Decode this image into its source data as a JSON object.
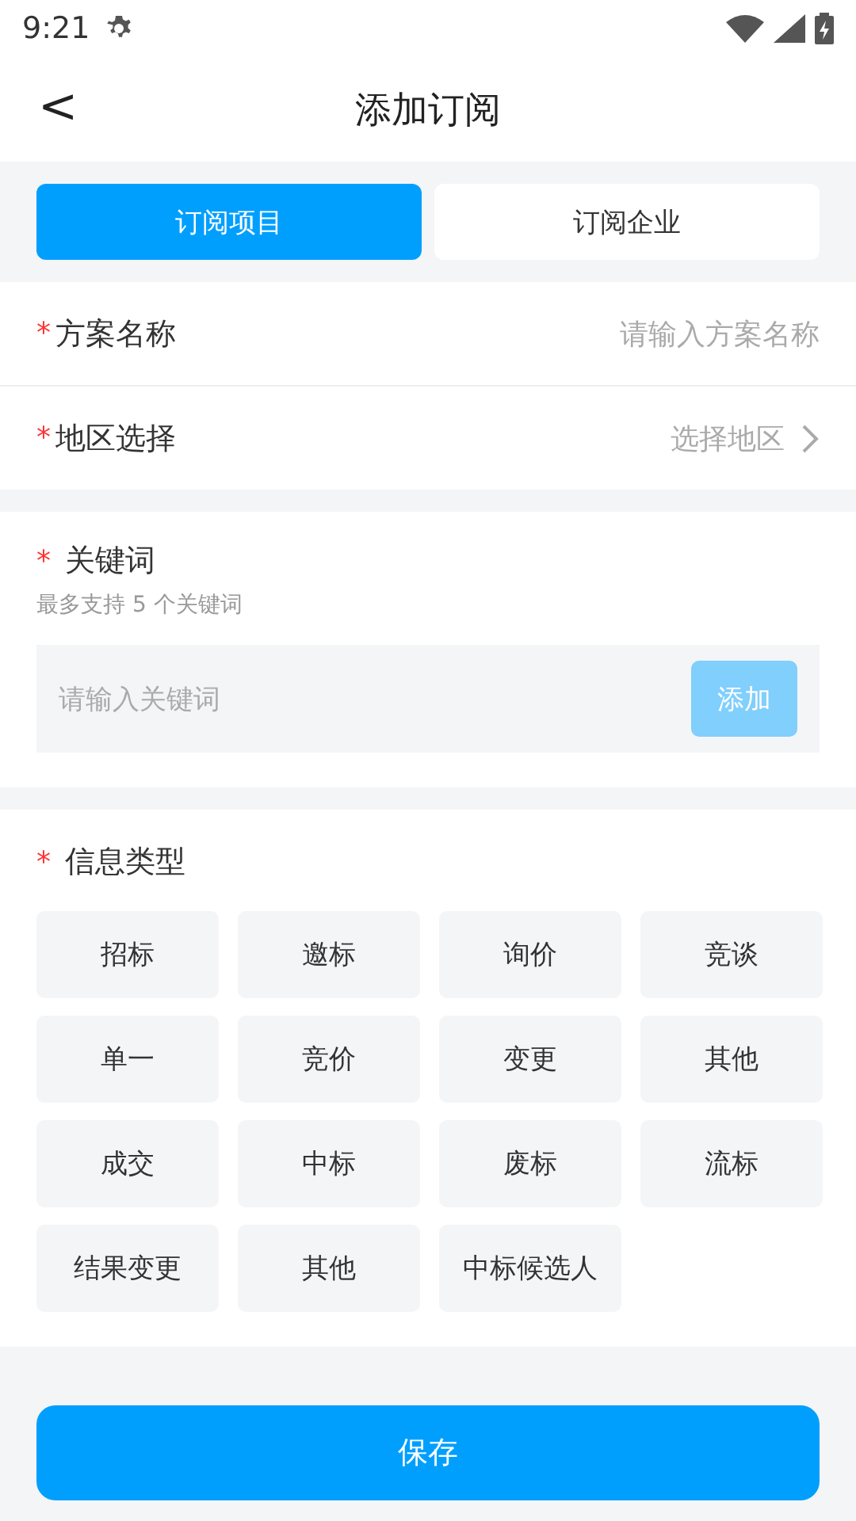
{
  "status_bar": {
    "time": "9:21"
  },
  "header": {
    "back": "<",
    "title": "添加订阅"
  },
  "tabs": [
    {
      "label": "订阅项目",
      "selected": true
    },
    {
      "label": "订阅企业",
      "selected": false
    }
  ],
  "form_rows": [
    {
      "required": "*",
      "label": "方案名称",
      "placeholder": "请输入方案名称",
      "kind": "input"
    },
    {
      "required": "*",
      "label": "地区选择",
      "placeholder": "选择地区",
      "kind": "select"
    }
  ],
  "keywords": {
    "required": "*",
    "title": "关键词",
    "hint": "最多支持 5 个关键词",
    "placeholder": "请输入关键词",
    "add_button": "添加",
    "add_disabled": true
  },
  "info_types": {
    "required": "*",
    "title": "信息类型",
    "options": [
      {
        "label": "招标",
        "selected": false
      },
      {
        "label": "邀标",
        "selected": false
      },
      {
        "label": "询价",
        "selected": false
      },
      {
        "label": "竞谈",
        "selected": false
      },
      {
        "label": "单一",
        "selected": false
      },
      {
        "label": "竞价",
        "selected": false
      },
      {
        "label": "变更",
        "selected": false
      },
      {
        "label": "其他",
        "selected": false
      },
      {
        "label": "成交",
        "selected": false
      },
      {
        "label": "中标",
        "selected": false
      },
      {
        "label": "废标",
        "selected": false
      },
      {
        "label": "流标",
        "selected": false
      },
      {
        "label": "结果变更",
        "selected": false
      },
      {
        "label": "其他",
        "selected": false
      },
      {
        "label": "中标候选人",
        "selected": false
      }
    ]
  },
  "save_button": "保存"
}
